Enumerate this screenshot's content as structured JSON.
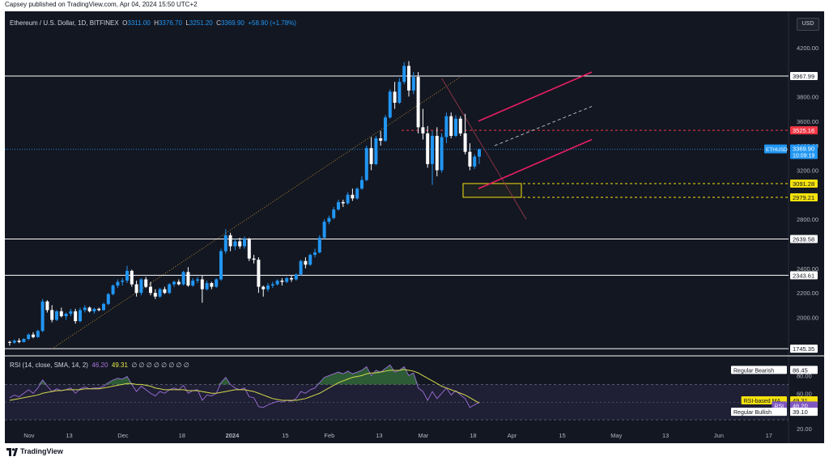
{
  "header": {
    "publisher": "Capsey published on TradingView.com, Apr 04, 2024 15:50 UTC+2"
  },
  "legend": {
    "symbol": "Ethereum / U.S. Dollar, 1D, BITFINEX",
    "o_label": "O",
    "o": "3311.00",
    "h_label": "H",
    "h": "3376.70",
    "l_label": "L",
    "l": "3251.20",
    "c_label": "C",
    "c": "3369.90",
    "change": "+58.90 (+1.78%)"
  },
  "rsi_legend": {
    "label": "RSI (14, close, SMA, 14, 2)",
    "rsi_value": "46.20",
    "ma_value": "49.31",
    "extra": "∅ ∅ ∅ ∅ ∅ ∅ ∅ ∅"
  },
  "currency": "USD",
  "footer": {
    "brand": "TradingView"
  },
  "colors": {
    "background": "#131722",
    "up": "#2196f3",
    "down": "#ffffff",
    "resistance": "#e91e63",
    "support_line": "#ffffff",
    "red_level": "#f23645",
    "yellow_level": "#f5e20d",
    "rsi": "#9c6fd6",
    "rsi_ma": "#d4d94a"
  },
  "chart_data": {
    "type": "candlestick",
    "symbol": "ETHUSD",
    "current_price": "3369.90",
    "countdown": "10:09:19",
    "ylim": [
      1700,
      4350
    ],
    "y_ticks": [
      "4200.00",
      "3800.00",
      "3600.00",
      "3400.00",
      "3200.00",
      "2800.00",
      "2400.00",
      "2200.00",
      "2000.00"
    ],
    "x_ticks": [
      "Nov",
      "13",
      "Dec",
      "18",
      "2024",
      "15",
      "Feb",
      "13",
      "Mar",
      "18",
      "Apr",
      "15",
      "May",
      "13",
      "Jun",
      "17"
    ],
    "horizontal_levels": [
      {
        "label": "3967.99",
        "value": 3967.99,
        "style": "solid-white"
      },
      {
        "label": "3525.16",
        "value": 3525.16,
        "style": "dashed-red"
      },
      {
        "label": "3091.28",
        "value": 3091.28,
        "style": "dashed-yellow"
      },
      {
        "label": "2979.21",
        "value": 2979.21,
        "style": "dashed-yellow"
      },
      {
        "label": "2639.58",
        "value": 2639.58,
        "style": "solid-white"
      },
      {
        "label": "2343.61",
        "value": 2343.61,
        "style": "solid-white"
      },
      {
        "label": "1745.35",
        "value": 1745.35,
        "style": "solid-white"
      }
    ],
    "candles": [
      [
        1800,
        1810,
        1770,
        1795
      ],
      [
        1795,
        1820,
        1785,
        1810
      ],
      [
        1810,
        1830,
        1790,
        1800
      ],
      [
        1800,
        1830,
        1795,
        1825
      ],
      [
        1825,
        1870,
        1815,
        1860
      ],
      [
        1860,
        1880,
        1830,
        1840
      ],
      [
        1840,
        1900,
        1835,
        1890
      ],
      [
        1890,
        2150,
        1880,
        2130
      ],
      [
        2130,
        2140,
        2040,
        2060
      ],
      [
        2060,
        2100,
        1960,
        1980
      ],
      [
        1980,
        2060,
        1970,
        2050
      ],
      [
        2050,
        2080,
        2000,
        2010
      ],
      [
        2010,
        2040,
        1980,
        2030
      ],
      [
        2030,
        2070,
        2010,
        2050
      ],
      [
        2050,
        2070,
        1950,
        1970
      ],
      [
        1970,
        2080,
        1960,
        2060
      ],
      [
        2060,
        2100,
        2040,
        2080
      ],
      [
        2080,
        2090,
        2040,
        2050
      ],
      [
        2050,
        2080,
        2030,
        2070
      ],
      [
        2070,
        2080,
        2050,
        2060
      ],
      [
        2060,
        2120,
        2055,
        2110
      ],
      [
        2110,
        2200,
        2100,
        2190
      ],
      [
        2190,
        2270,
        2180,
        2260
      ],
      [
        2260,
        2310,
        2240,
        2290
      ],
      [
        2290,
        2320,
        2260,
        2300
      ],
      [
        2300,
        2420,
        2280,
        2380
      ],
      [
        2380,
        2390,
        2250,
        2270
      ],
      [
        2270,
        2300,
        2170,
        2200
      ],
      [
        2200,
        2320,
        2180,
        2310
      ],
      [
        2310,
        2330,
        2240,
        2250
      ],
      [
        2250,
        2290,
        2180,
        2200
      ],
      [
        2200,
        2230,
        2150,
        2170
      ],
      [
        2170,
        2240,
        2160,
        2230
      ],
      [
        2230,
        2250,
        2190,
        2200
      ],
      [
        2200,
        2280,
        2190,
        2270
      ],
      [
        2270,
        2300,
        2250,
        2290
      ],
      [
        2290,
        2310,
        2260,
        2270
      ],
      [
        2270,
        2380,
        2260,
        2370
      ],
      [
        2370,
        2410,
        2250,
        2260
      ],
      [
        2260,
        2320,
        2250,
        2300
      ],
      [
        2300,
        2330,
        2280,
        2310
      ],
      [
        2310,
        2340,
        2120,
        2230
      ],
      [
        2230,
        2300,
        2220,
        2280
      ],
      [
        2280,
        2290,
        2230,
        2250
      ],
      [
        2250,
        2320,
        2240,
        2310
      ],
      [
        2310,
        2560,
        2300,
        2540
      ],
      [
        2540,
        2720,
        2520,
        2670
      ],
      [
        2670,
        2690,
        2540,
        2580
      ],
      [
        2580,
        2640,
        2550,
        2620
      ],
      [
        2620,
        2650,
        2560,
        2580
      ],
      [
        2580,
        2660,
        2560,
        2640
      ],
      [
        2640,
        2650,
        2460,
        2480
      ],
      [
        2480,
        2510,
        2440,
        2470
      ],
      [
        2470,
        2490,
        2200,
        2250
      ],
      [
        2250,
        2260,
        2170,
        2230
      ],
      [
        2230,
        2280,
        2210,
        2260
      ],
      [
        2260,
        2290,
        2240,
        2270
      ],
      [
        2270,
        2310,
        2260,
        2300
      ],
      [
        2300,
        2320,
        2260,
        2290
      ],
      [
        2290,
        2330,
        2280,
        2320
      ],
      [
        2320,
        2340,
        2290,
        2310
      ],
      [
        2310,
        2360,
        2300,
        2350
      ],
      [
        2350,
        2470,
        2340,
        2460
      ],
      [
        2460,
        2490,
        2400,
        2430
      ],
      [
        2430,
        2520,
        2420,
        2510
      ],
      [
        2510,
        2560,
        2490,
        2530
      ],
      [
        2530,
        2670,
        2520,
        2650
      ],
      [
        2650,
        2800,
        2640,
        2780
      ],
      [
        2780,
        2830,
        2760,
        2810
      ],
      [
        2810,
        2900,
        2800,
        2880
      ],
      [
        2880,
        2960,
        2870,
        2940
      ],
      [
        2940,
        2960,
        2900,
        2930
      ],
      [
        2930,
        3020,
        2920,
        3000
      ],
      [
        3000,
        3050,
        2950,
        2970
      ],
      [
        2970,
        3060,
        2960,
        3050
      ],
      [
        3050,
        3150,
        3040,
        3120
      ],
      [
        3120,
        3400,
        3110,
        3380
      ],
      [
        3380,
        3470,
        3200,
        3250
      ],
      [
        3250,
        3480,
        3240,
        3460
      ],
      [
        3460,
        3520,
        3400,
        3440
      ],
      [
        3440,
        3650,
        3430,
        3630
      ],
      [
        3630,
        3860,
        3620,
        3840
      ],
      [
        3840,
        3920,
        3700,
        3750
      ],
      [
        3750,
        3950,
        3740,
        3920
      ],
      [
        3920,
        4080,
        3900,
        4050
      ],
      [
        4050,
        4090,
        3800,
        3850
      ],
      [
        3850,
        4000,
        3820,
        3960
      ],
      [
        3960,
        4000,
        3500,
        3550
      ],
      [
        3550,
        3700,
        3450,
        3500
      ],
      [
        3500,
        3560,
        3220,
        3250
      ],
      [
        3250,
        3520,
        3080,
        3480
      ],
      [
        3480,
        3550,
        3150,
        3200
      ],
      [
        3200,
        3500,
        3180,
        3470
      ],
      [
        3470,
        3670,
        3420,
        3640
      ],
      [
        3640,
        3670,
        3460,
        3480
      ],
      [
        3480,
        3650,
        3470,
        3620
      ],
      [
        3620,
        3640,
        3480,
        3500
      ],
      [
        3500,
        3660,
        3330,
        3350
      ],
      [
        3350,
        3420,
        3200,
        3230
      ],
      [
        3230,
        3330,
        3210,
        3311
      ],
      [
        3311,
        3377,
        3251,
        3370
      ]
    ],
    "rsi": {
      "ylim": [
        20,
        95
      ],
      "y_ticks": [
        "80.00",
        "60.00",
        "40.00",
        "20.00"
      ],
      "upper_band": 70,
      "lower_band": 30,
      "labels": [
        {
          "text": "Regular Bearish",
          "value": "86.45"
        },
        {
          "text": "RSI-based MA",
          "value": "49.31"
        },
        {
          "text": "RSI",
          "value": "46.20"
        },
        {
          "text": "Regular Bullish",
          "value": "39.10"
        }
      ],
      "rsi_values": [
        55,
        58,
        56,
        60,
        64,
        60,
        66,
        75,
        68,
        62,
        65,
        63,
        64,
        66,
        60,
        65,
        67,
        65,
        66,
        66,
        68,
        72,
        75,
        77,
        76,
        79,
        70,
        62,
        68,
        64,
        60,
        57,
        62,
        60,
        64,
        66,
        64,
        69,
        60,
        63,
        64,
        52,
        58,
        57,
        60,
        72,
        78,
        70,
        66,
        64,
        66,
        56,
        55,
        45,
        44,
        47,
        49,
        51,
        50,
        52,
        51,
        54,
        62,
        60,
        64,
        66,
        72,
        78,
        80,
        82,
        84,
        82,
        85,
        82,
        84,
        86,
        90,
        80,
        86,
        84,
        88,
        92,
        84,
        86,
        90,
        80,
        83,
        66,
        62,
        52,
        62,
        54,
        60,
        66,
        58,
        63,
        58,
        54,
        44,
        47,
        50
      ],
      "ma_values": [
        52,
        53,
        54,
        55,
        56,
        57,
        58,
        60,
        61,
        62,
        63,
        63,
        64,
        64,
        64,
        64,
        65,
        65,
        65,
        65,
        66,
        67,
        68,
        69,
        70,
        71,
        71,
        70,
        70,
        69,
        68,
        66,
        65,
        64,
        64,
        64,
        64,
        64,
        63,
        63,
        63,
        62,
        61,
        60,
        60,
        61,
        62,
        63,
        64,
        64,
        64,
        63,
        62,
        60,
        58,
        56,
        54,
        53,
        52,
        52,
        52,
        52,
        53,
        54,
        56,
        58,
        60,
        63,
        66,
        69,
        72,
        74,
        76,
        78,
        79,
        80,
        82,
        83,
        83,
        84,
        85,
        86,
        86,
        86,
        87,
        86,
        85,
        83,
        80,
        77,
        74,
        71,
        68,
        66,
        64,
        62,
        60,
        58,
        55,
        52,
        49
      ]
    }
  }
}
